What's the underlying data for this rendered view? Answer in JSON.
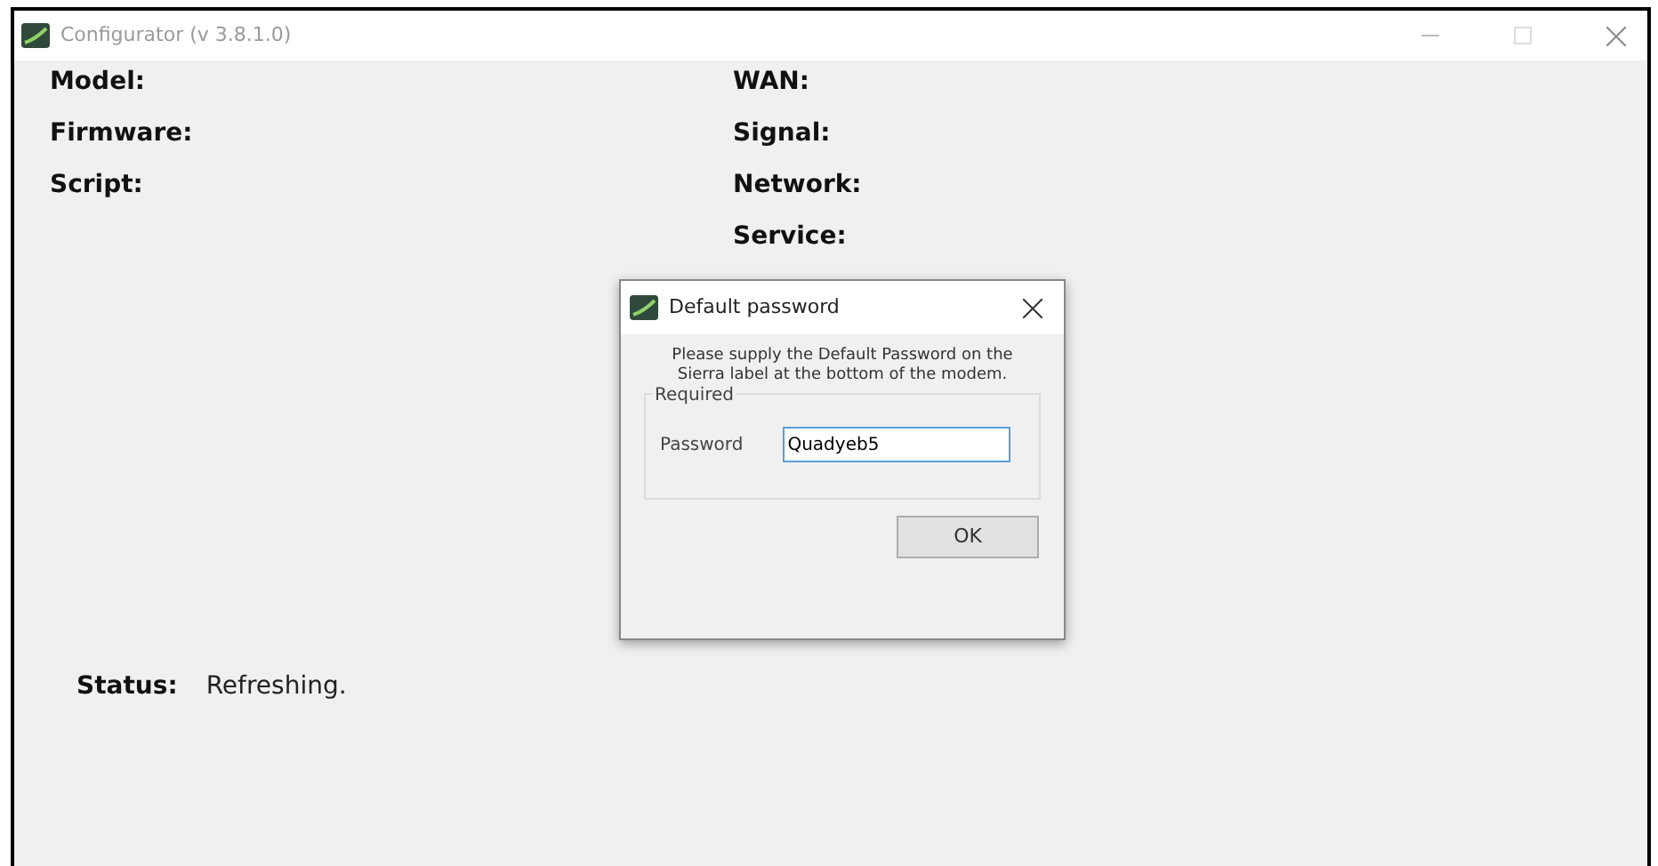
{
  "window": {
    "title": "Configurator (v 3.8.1.0)"
  },
  "left_fields": [
    "Model:",
    "Firmware:",
    "Script:"
  ],
  "right_fields": [
    "WAN:",
    "Signal:",
    "Network:",
    "Service:"
  ],
  "status": {
    "label": "Status:",
    "value": "Refreshing."
  },
  "dialog": {
    "title": "Default password",
    "message": "Please supply the Default Password on the Sierra label at the bottom of the modem.",
    "group": "Required",
    "field_label": "Password",
    "value": "Quadyeb5",
    "button": "OK"
  }
}
